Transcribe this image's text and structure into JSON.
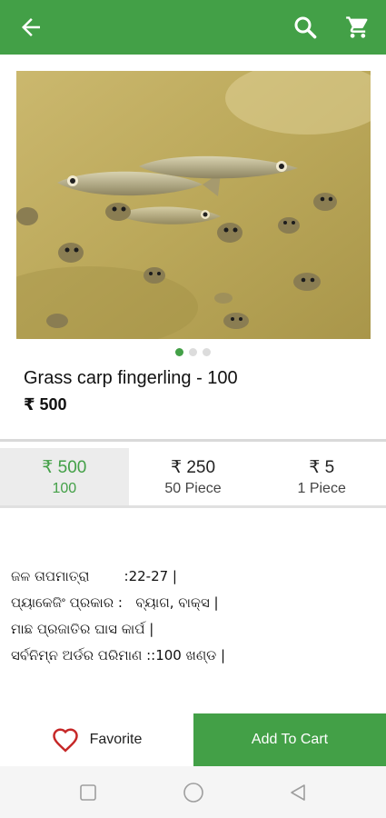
{
  "appbar": {
    "back_icon": "arrow-left-icon",
    "search_icon": "search-icon",
    "cart_icon": "shopping-cart-icon",
    "color": "#43a047"
  },
  "gallery": {
    "image_alt": "Grass carp fingerlings swimming in water",
    "total_images": 3,
    "active_index": 0
  },
  "product": {
    "title": "Grass carp fingerling - 100",
    "price": "₹ 500"
  },
  "variants": [
    {
      "price": "₹ 500",
      "quantity": "100",
      "selected": true
    },
    {
      "price": "₹ 250",
      "quantity": "50 Piece",
      "selected": false
    },
    {
      "price": "₹ 5",
      "quantity": "1 Piece",
      "selected": false
    }
  ],
  "description": [
    "ଜଳ ତାପମାତ୍ରା        :22-27 |",
    "ପ୍ୟାକେଜିଂ ପ୍ରକାର :   ବ୍ୟାଗ, ବାକ୍ସ |",
    "ମାଛ ପ୍ରଜାତିର ଘାସ କାର୍ପ |",
    "ସର୍ବନିମ୍ନ ଅର୍ଡର ପରିମାଣ ::100 ଖଣ୍ଡ |"
  ],
  "actions": {
    "favorite_label": "Favorite",
    "add_to_cart_label": "Add To Cart"
  },
  "system_nav": {
    "recents_icon": "square-icon",
    "home_icon": "circle-icon",
    "back_icon": "triangle-back-icon"
  }
}
